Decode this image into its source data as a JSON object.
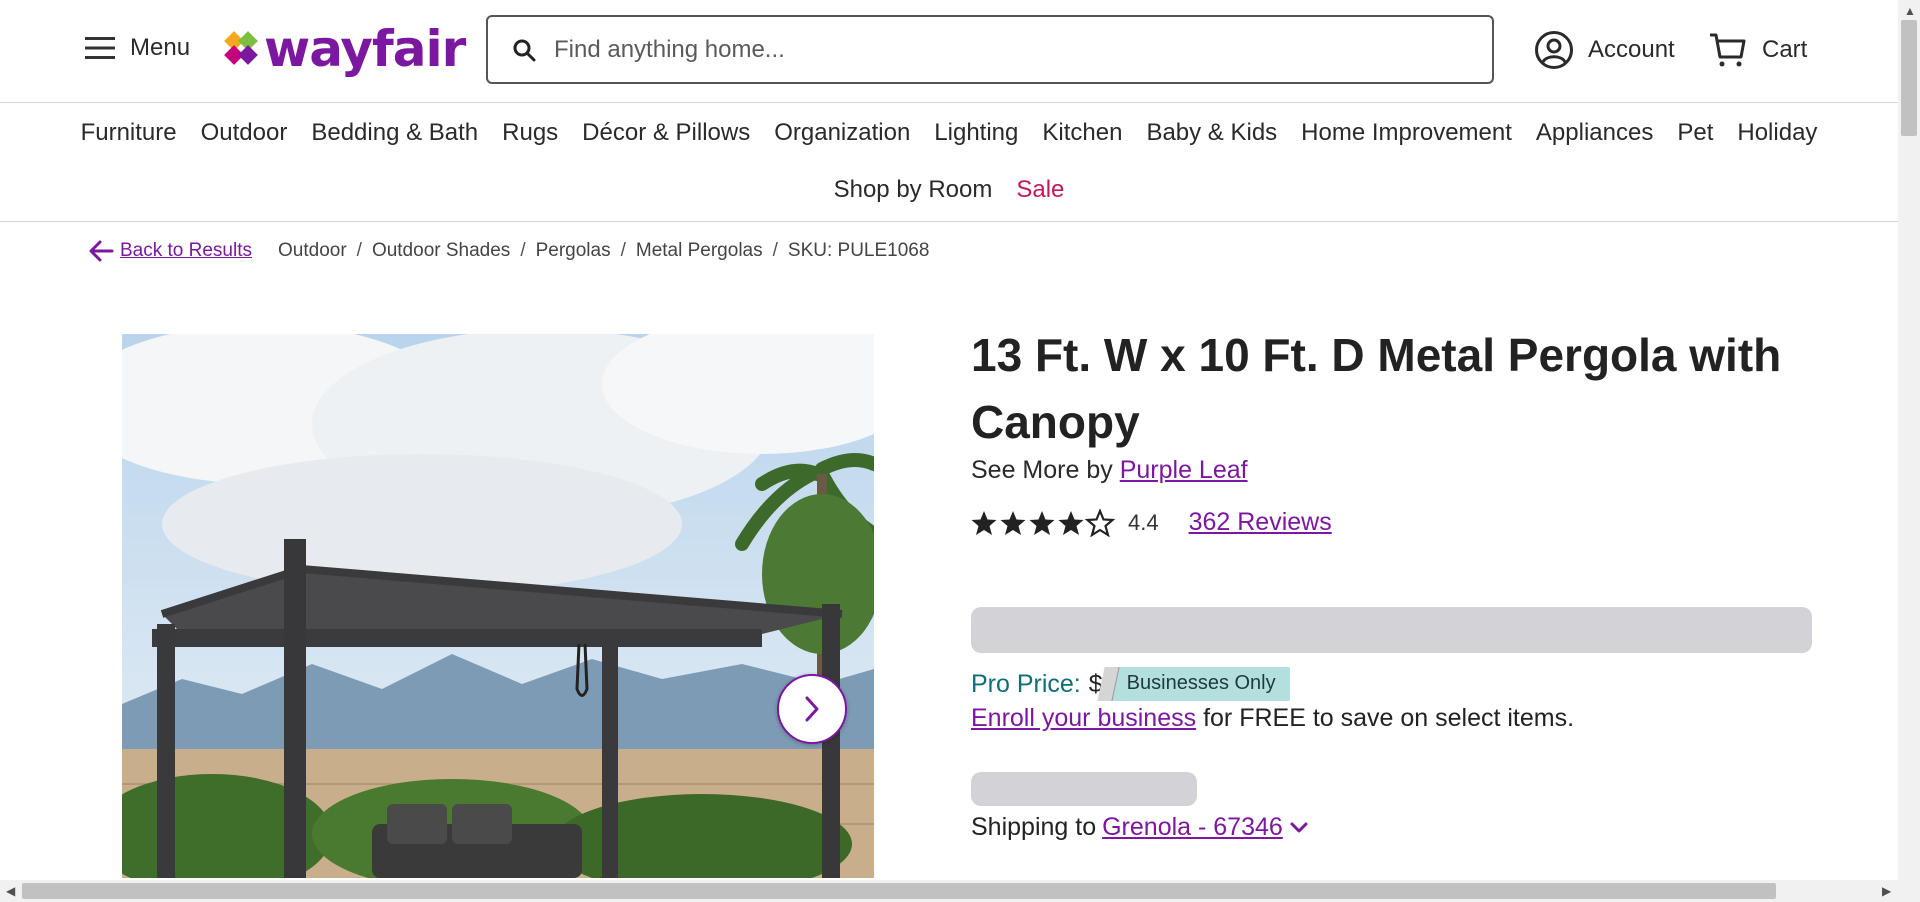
{
  "header": {
    "menu_label": "Menu",
    "logo_text": "wayfair",
    "search_placeholder": "Find anything home...",
    "account_label": "Account",
    "cart_label": "Cart"
  },
  "categories_row1": [
    "Furniture",
    "Outdoor",
    "Bedding & Bath",
    "Rugs",
    "Décor & Pillows",
    "Organization",
    "Lighting",
    "Kitchen",
    "Baby & Kids",
    "Home Improvement",
    "Appliances",
    "Pet",
    "Holiday"
  ],
  "categories_row2": [
    "Shop by Room",
    "Sale"
  ],
  "breadcrumb": {
    "back_label": "Back to Results",
    "items": [
      "Outdoor",
      "Outdoor Shades",
      "Pergolas",
      "Metal Pergolas"
    ],
    "sku": "SKU: PULE1068"
  },
  "product": {
    "title": "13 Ft. W x 10 Ft. D Metal Pergola with Canopy",
    "see_more_prefix": "See More by",
    "brand": "Purple Leaf",
    "rating_value": "4.4",
    "rating_stars": 4.5,
    "reviews_label": "362 Reviews",
    "pro_price_label": "Pro Price:",
    "pro_price_symbol": "$",
    "businesses_only": "Businesses Only",
    "enroll_link": "Enroll your business",
    "enroll_text": "for FREE to save on select items.",
    "shipping_prefix": "Shipping to",
    "shipping_location": "Grenola - 67346"
  },
  "colors": {
    "brand_purple": "#7b189f",
    "sale_red": "#c2185b",
    "pro_teal": "#0f6e78",
    "skeleton": "#d2d2d7"
  },
  "icons": [
    "hamburger-icon",
    "logo-icon",
    "search-icon",
    "account-icon",
    "cart-icon",
    "back-arrow-icon",
    "star-icon",
    "chevron-right-icon",
    "chevron-down-icon"
  ]
}
